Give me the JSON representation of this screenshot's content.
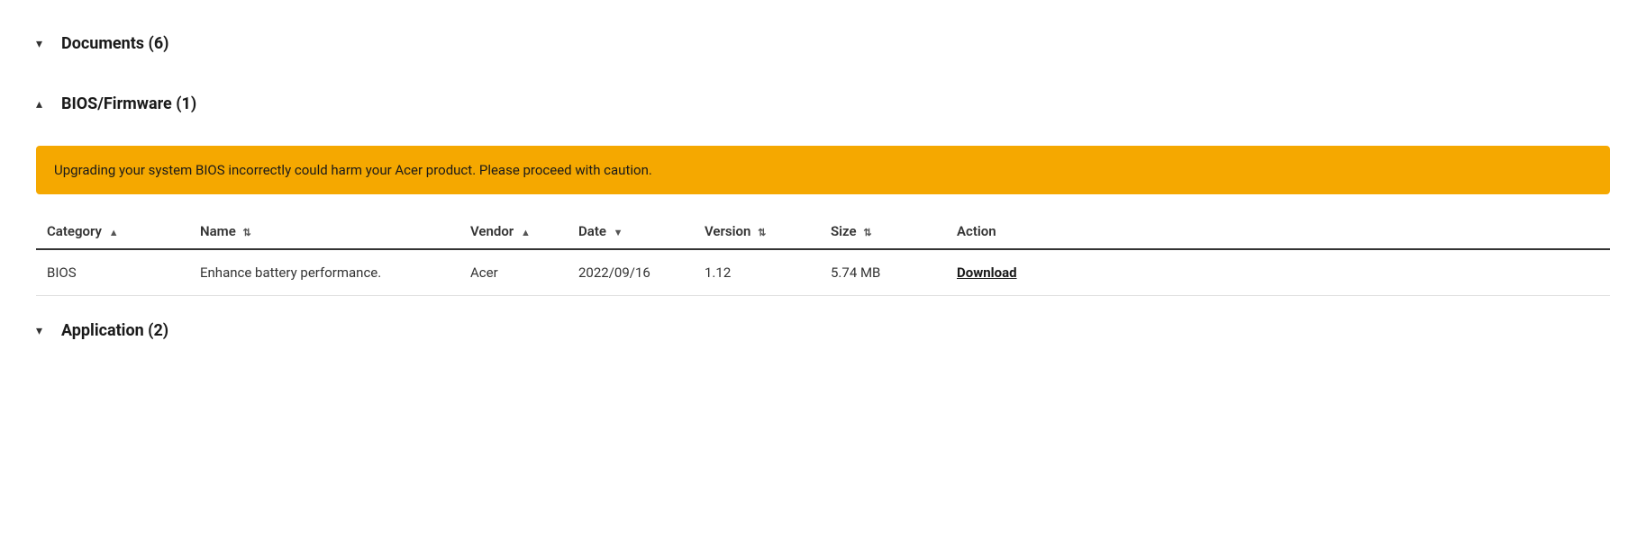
{
  "sections": {
    "documents": {
      "label": "Documents (6)",
      "chevron": "▾",
      "expanded": false
    },
    "bios": {
      "label": "BIOS/Firmware (1)",
      "chevron": "▴",
      "expanded": true,
      "warning": "Upgrading your system BIOS incorrectly could harm your Acer product. Please proceed with caution.",
      "table": {
        "columns": [
          {
            "key": "category",
            "label": "Category",
            "sort": "▲"
          },
          {
            "key": "name",
            "label": "Name",
            "sort": "⇅"
          },
          {
            "key": "vendor",
            "label": "Vendor",
            "sort": "▲"
          },
          {
            "key": "date",
            "label": "Date",
            "sort": "▼"
          },
          {
            "key": "version",
            "label": "Version",
            "sort": "⇅"
          },
          {
            "key": "size",
            "label": "Size",
            "sort": "⇅"
          },
          {
            "key": "action",
            "label": "Action",
            "sort": ""
          }
        ],
        "rows": [
          {
            "category": "BIOS",
            "name": "Enhance battery performance.",
            "vendor": "Acer",
            "date": "2022/09/16",
            "version": "1.12",
            "size": "5.74 MB",
            "action": "Download"
          }
        ]
      }
    },
    "application": {
      "label": "Application (2)",
      "chevron": "▾",
      "expanded": false
    }
  }
}
